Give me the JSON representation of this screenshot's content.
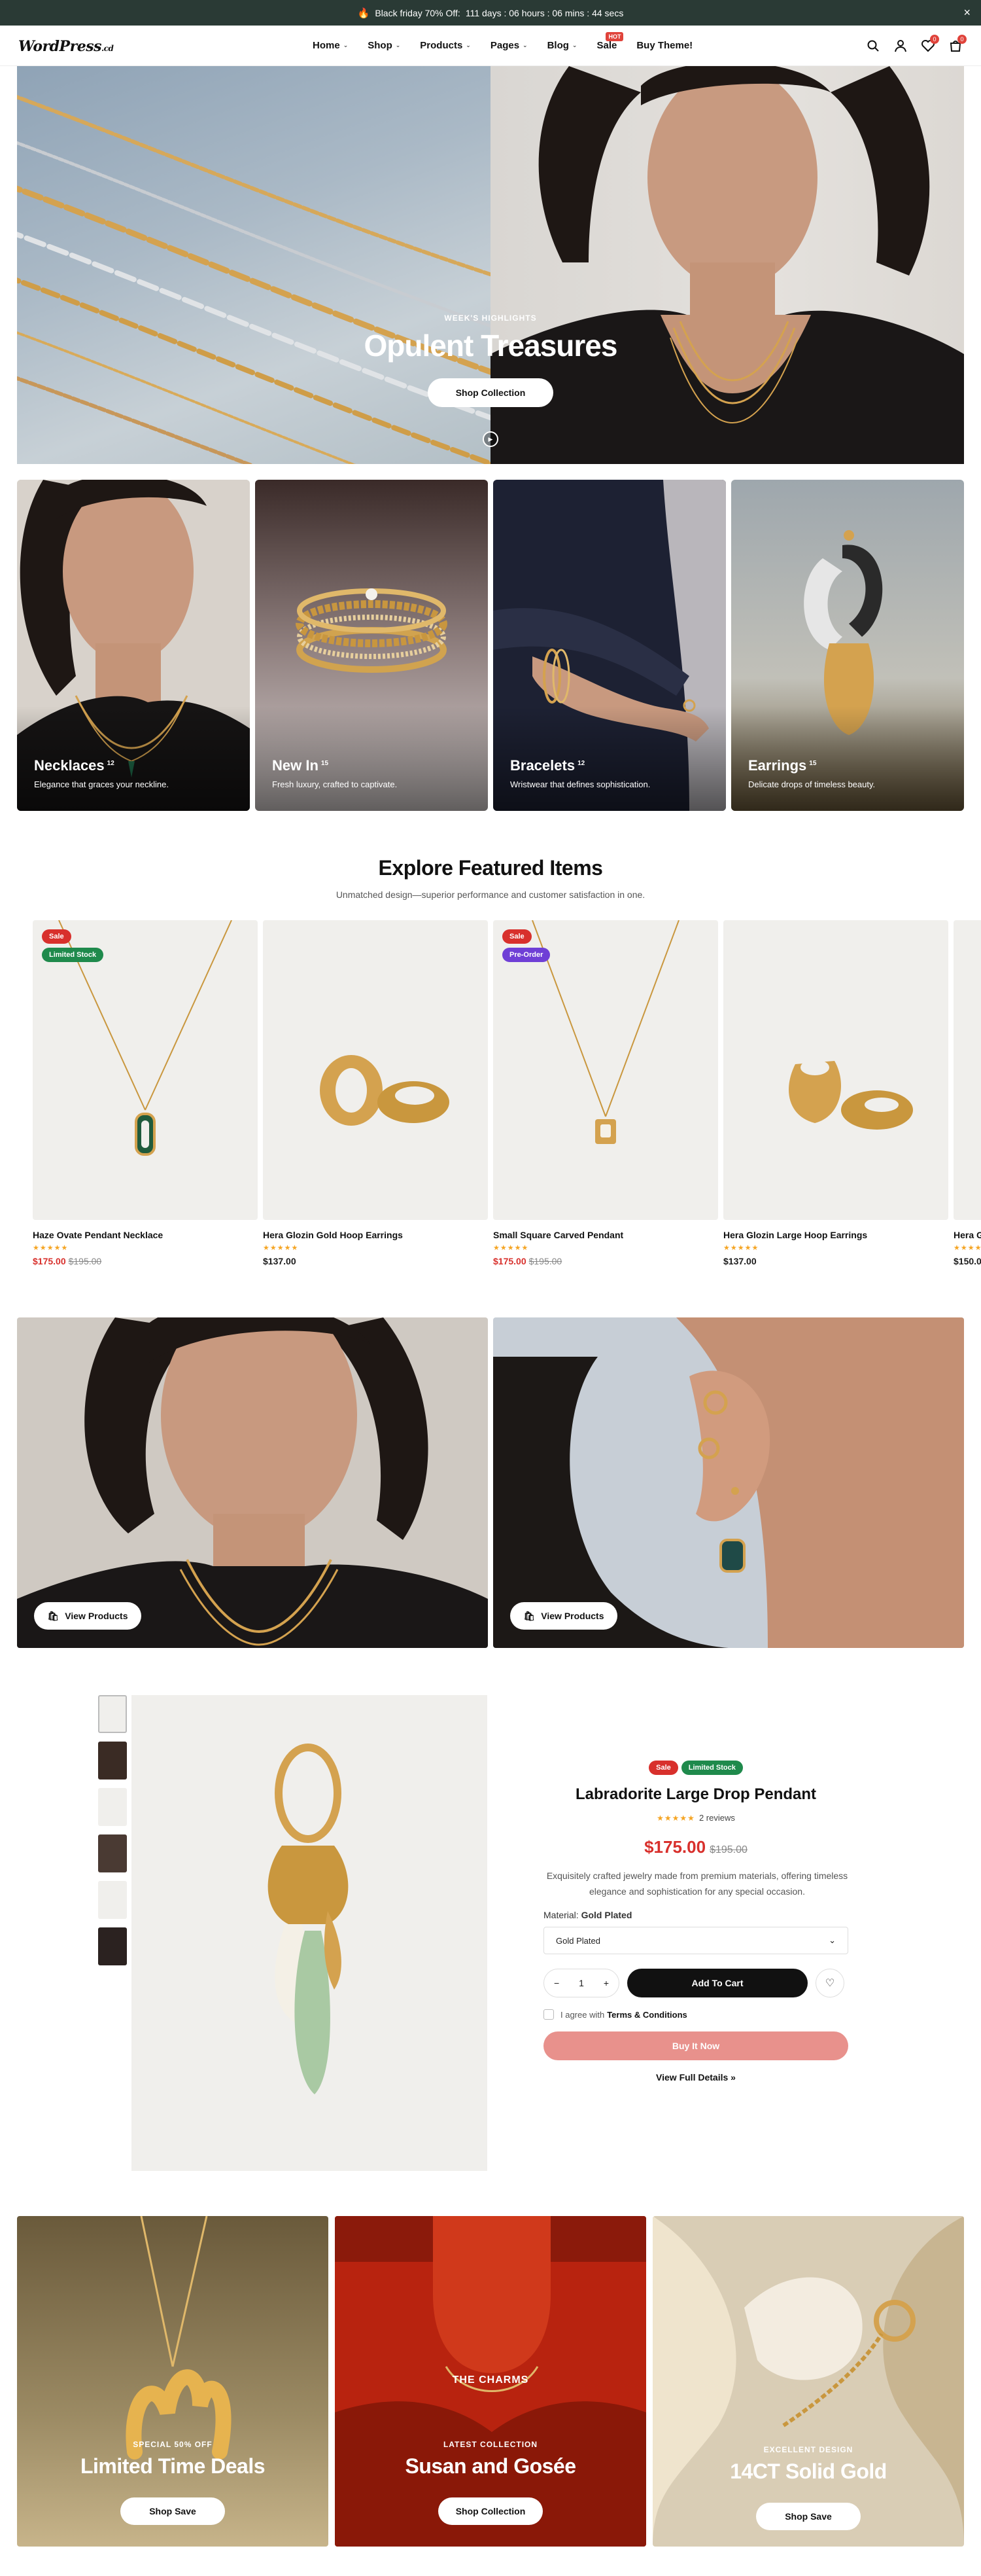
{
  "announcement": {
    "text": "Black friday 70% Off:",
    "timer": "111 days : 06 hours : 06 mins : 44 secs"
  },
  "header": {
    "logo": "WordPress",
    "logo_suffix": ".cd",
    "nav": [
      {
        "label": "Home"
      },
      {
        "label": "Shop"
      },
      {
        "label": "Products"
      },
      {
        "label": "Pages"
      },
      {
        "label": "Blog"
      },
      {
        "label": "Sale",
        "badge": "HOT"
      },
      {
        "label": "Buy Theme!"
      }
    ],
    "wishlist_count": "0",
    "cart_count": "0",
    "icons": [
      "search-icon",
      "user-icon",
      "heart-icon",
      "cart-icon"
    ]
  },
  "hero": {
    "eyebrow": "WEEK'S HIGHLIGHTS",
    "title": "Opulent Treasures",
    "button": "Shop Collection"
  },
  "categories": [
    {
      "name": "Necklaces",
      "count": "12",
      "subtitle": "Elegance that graces your neckline."
    },
    {
      "name": "New In",
      "count": "15",
      "subtitle": "Fresh luxury, crafted to captivate."
    },
    {
      "name": "Bracelets",
      "count": "12",
      "subtitle": "Wristwear that defines sophistication."
    },
    {
      "name": "Earrings",
      "count": "15",
      "subtitle": "Delicate drops of timeless beauty."
    }
  ],
  "featured": {
    "title": "Explore Featured Items",
    "subtitle": "Unmatched design—superior performance and customer satisfaction in one.",
    "products": [
      {
        "name": "Haze Ovate Pendant Necklace",
        "price": "$175.00",
        "old_price": "$195.00",
        "badges": [
          "Sale",
          "Limited Stock"
        ],
        "on_sale": true
      },
      {
        "name": "Hera Glozin Gold Hoop Earrings",
        "price": "$137.00",
        "old_price": "",
        "badges": [],
        "on_sale": false
      },
      {
        "name": "Small Square Carved Pendant",
        "price": "$175.00",
        "old_price": "$195.00",
        "badges": [
          "Sale",
          "Pre-Order"
        ],
        "on_sale": true
      },
      {
        "name": "Hera Glozin Large Hoop Earrings",
        "price": "$137.00",
        "old_price": "",
        "badges": [],
        "on_sale": false
      },
      {
        "name": "Hera G",
        "price": "$150.0",
        "old_price": "",
        "badges": [],
        "on_sale": false
      }
    ],
    "stars": "★★★★★"
  },
  "promos": [
    {
      "button": "View Products"
    },
    {
      "button": "View Products"
    }
  ],
  "single_product": {
    "badges": [
      "Sale",
      "Limited Stock"
    ],
    "title": "Labradorite Large Drop Pendant",
    "stars": "★★★★★",
    "reviews": "2 reviews",
    "price": "$175.00",
    "old_price": "$195.00",
    "description": "Exquisitely crafted jewelry made from premium materials, offering timeless elegance and sophistication for any special occasion.",
    "material_label": "Material:",
    "material_value": "Gold Plated",
    "select_value": "Gold Plated",
    "qty": "1",
    "add_to_cart": "Add To Cart",
    "agree_prefix": "I agree with",
    "agree_link": "Terms & Conditions",
    "buy_now": "Buy It Now",
    "full_details": "View Full Details"
  },
  "collections": [
    {
      "eyebrow": "SPECIAL 50% OFF",
      "title": "Limited Time Deals",
      "button": "Shop Save"
    },
    {
      "overlay": "THE CHARMS",
      "eyebrow": "LATEST COLLECTION",
      "title": "Susan and Gosée",
      "button": "Shop Collection"
    },
    {
      "eyebrow": "EXCELLENT DESIGN",
      "title": "14CT Solid Gold",
      "button": "Shop Save"
    }
  ],
  "colors": {
    "announce_bg": "#2a3a35",
    "sale_red": "#d8302c",
    "stock_green": "#1f8a4c",
    "preorder_purple": "#6f3fd6",
    "buy_now_pink": "#e8918c"
  }
}
